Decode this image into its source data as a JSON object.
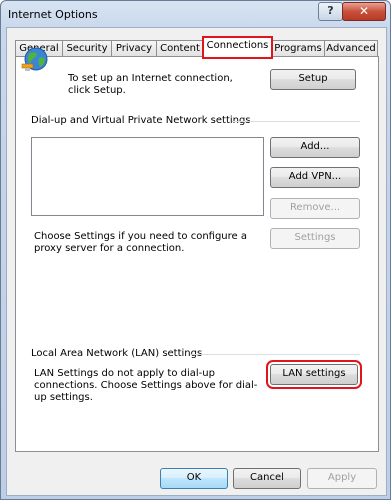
{
  "window": {
    "title": "Internet Options",
    "help_glyph": "?",
    "close_glyph": "✕"
  },
  "tabs": [
    {
      "label": "General"
    },
    {
      "label": "Security"
    },
    {
      "label": "Privacy"
    },
    {
      "label": "Content"
    },
    {
      "label": "Connections",
      "active": true
    },
    {
      "label": "Programs"
    },
    {
      "label": "Advanced"
    }
  ],
  "setup_text": "To set up an Internet connection, click Setup.",
  "setup_button": "Setup",
  "dialup_group_label": "Dial-up and Virtual Private Network settings",
  "add_button": "Add...",
  "add_vpn_button": "Add VPN...",
  "remove_button": "Remove...",
  "settings_button": "Settings",
  "proxy_text": "Choose Settings if you need to configure a proxy server for a connection.",
  "lan_group_label": "Local Area Network (LAN) settings",
  "lan_text": "LAN Settings do not apply to dial-up connections. Choose Settings above for dial-up settings.",
  "lan_settings_button": "LAN settings",
  "footer": {
    "ok": "OK",
    "cancel": "Cancel",
    "apply": "Apply"
  },
  "highlight_color": "#e0141b"
}
